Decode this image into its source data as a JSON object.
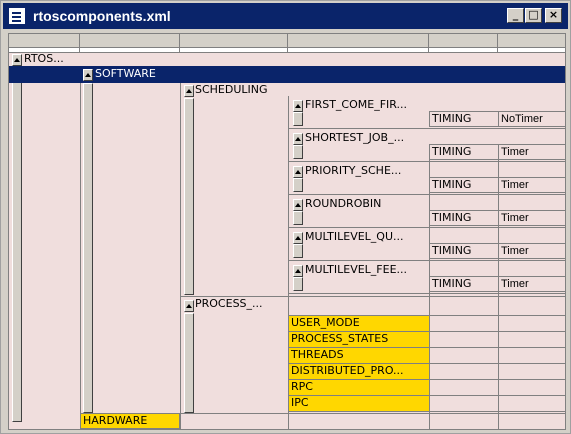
{
  "window": {
    "title": "rtoscomponents.xml"
  },
  "title_buttons": {
    "minimize": "_",
    "maximize": "□",
    "close": "×"
  },
  "tree": {
    "root": "RTOS...",
    "software": "SOFTWARE",
    "scheduling": "SCHEDULING",
    "hardware": "HARDWARE",
    "process": "PROCESS_...",
    "algorithms": [
      {
        "name": "FIRST_COME_FIR...",
        "attr": "TIMING",
        "value": "NoTimer"
      },
      {
        "name": "SHORTEST_JOB_...",
        "attr": "TIMING",
        "value": "Timer"
      },
      {
        "name": "PRIORITY_SCHE...",
        "attr": "TIMING",
        "value": "Timer"
      },
      {
        "name": "ROUNDROBIN",
        "attr": "TIMING",
        "value": "Timer"
      },
      {
        "name": "MULTILEVEL_QU...",
        "attr": "TIMING",
        "value": "Timer"
      },
      {
        "name": "MULTILEVEL_FEE...",
        "attr": "TIMING",
        "value": "Timer"
      }
    ],
    "process_items": [
      "USER_MODE",
      "PROCESS_STATES",
      "THREADS",
      "DISTRIBUTED_PRO...",
      "RPC",
      "IPC"
    ]
  }
}
